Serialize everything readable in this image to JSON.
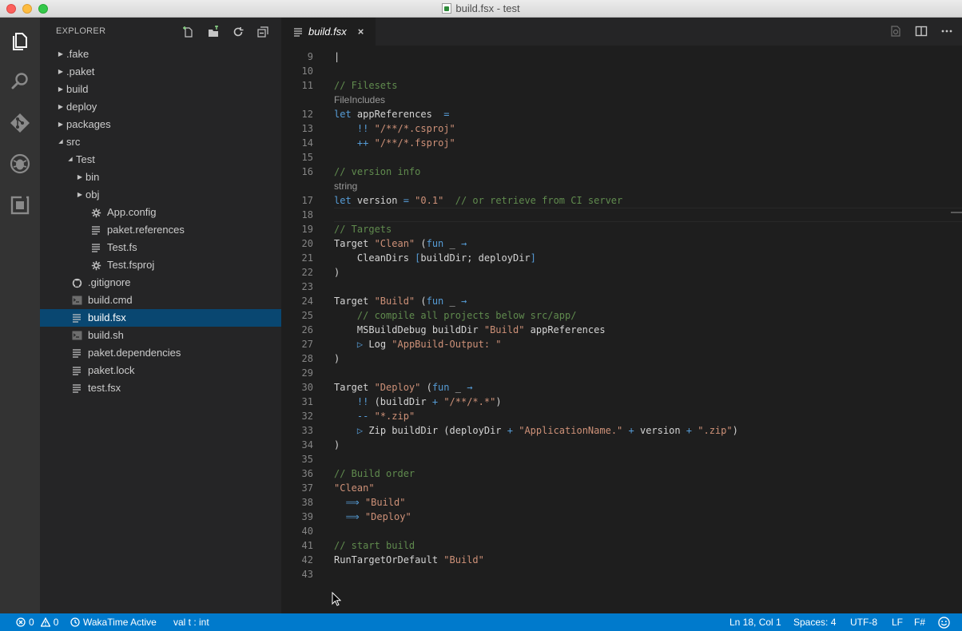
{
  "window": {
    "title": "build.fsx - test"
  },
  "sidebar": {
    "header": "EXPLORER",
    "tree": [
      {
        "label": ".fake",
        "depth": 0,
        "kind": "folder",
        "expanded": false
      },
      {
        "label": ".paket",
        "depth": 0,
        "kind": "folder",
        "expanded": false
      },
      {
        "label": "build",
        "depth": 0,
        "kind": "folder",
        "expanded": false
      },
      {
        "label": "deploy",
        "depth": 0,
        "kind": "folder",
        "expanded": false
      },
      {
        "label": "packages",
        "depth": 0,
        "kind": "folder",
        "expanded": false
      },
      {
        "label": "src",
        "depth": 0,
        "kind": "folder",
        "expanded": true
      },
      {
        "label": "Test",
        "depth": 1,
        "kind": "folder",
        "expanded": true
      },
      {
        "label": "bin",
        "depth": 2,
        "kind": "folder",
        "expanded": false
      },
      {
        "label": "obj",
        "depth": 2,
        "kind": "folder",
        "expanded": false
      },
      {
        "label": "App.config",
        "depth": 3,
        "kind": "gear"
      },
      {
        "label": "paket.references",
        "depth": 3,
        "kind": "lines"
      },
      {
        "label": "Test.fs",
        "depth": 3,
        "kind": "lines"
      },
      {
        "label": "Test.fsproj",
        "depth": 3,
        "kind": "gear"
      },
      {
        "label": ".gitignore",
        "depth": 1,
        "kind": "github"
      },
      {
        "label": "build.cmd",
        "depth": 1,
        "kind": "terminal"
      },
      {
        "label": "build.fsx",
        "depth": 1,
        "kind": "lines",
        "selected": true
      },
      {
        "label": "build.sh",
        "depth": 1,
        "kind": "terminal"
      },
      {
        "label": "paket.dependencies",
        "depth": 1,
        "kind": "lines"
      },
      {
        "label": "paket.lock",
        "depth": 1,
        "kind": "lines"
      },
      {
        "label": "test.fsx",
        "depth": 1,
        "kind": "lines"
      }
    ]
  },
  "editor": {
    "tab_label": "build.fsx",
    "tab_close": "×",
    "lines": [
      {
        "n": "9",
        "tokens": [
          [
            "|    ",
            "t-id"
          ]
        ]
      },
      {
        "n": "10",
        "tokens": []
      },
      {
        "n": "11",
        "tokens": [
          [
            "// Filesets",
            "t-c"
          ]
        ]
      },
      {
        "lens": "FileIncludes"
      },
      {
        "n": "12",
        "tokens": [
          [
            "let ",
            "t-k"
          ],
          [
            "appReferences",
            "t-id"
          ],
          [
            "  =",
            "t-o"
          ]
        ]
      },
      {
        "n": "13",
        "tokens": [
          [
            "    ",
            "t-id"
          ],
          [
            "!!",
            "t-o"
          ],
          [
            " ",
            "t-id"
          ],
          [
            "\"/**/*.csproj\"",
            "t-s"
          ]
        ]
      },
      {
        "n": "14",
        "tokens": [
          [
            "    ",
            "t-id"
          ],
          [
            "++",
            "t-o"
          ],
          [
            " ",
            "t-id"
          ],
          [
            "\"/**/*.fsproj\"",
            "t-s"
          ]
        ]
      },
      {
        "n": "15",
        "tokens": []
      },
      {
        "n": "16",
        "tokens": [
          [
            "// version info",
            "t-c"
          ]
        ]
      },
      {
        "lens": "string"
      },
      {
        "n": "17",
        "tokens": [
          [
            "let ",
            "t-k"
          ],
          [
            "version",
            "t-id"
          ],
          [
            " = ",
            "t-o"
          ],
          [
            "\"0.1\"",
            "t-s"
          ],
          [
            "  // or retrieve from CI server",
            "t-c"
          ]
        ]
      },
      {
        "n": "18",
        "tokens": [],
        "current": true
      },
      {
        "n": "19",
        "tokens": [
          [
            "// Targets",
            "t-c"
          ]
        ]
      },
      {
        "n": "20",
        "tokens": [
          [
            "Target ",
            "t-id"
          ],
          [
            "\"Clean\"",
            "t-s"
          ],
          [
            " (",
            "t-id"
          ],
          [
            "fun",
            "t-k"
          ],
          [
            " _ ",
            "t-id"
          ],
          [
            "→",
            "t-o"
          ]
        ]
      },
      {
        "n": "21",
        "tokens": [
          [
            "    CleanDirs ",
            "t-id"
          ],
          [
            "[",
            "t-k"
          ],
          [
            "buildDir; deployDir",
            "t-id"
          ],
          [
            "]",
            "t-k"
          ]
        ]
      },
      {
        "n": "22",
        "tokens": [
          [
            ")",
            "t-id"
          ]
        ]
      },
      {
        "n": "23",
        "tokens": []
      },
      {
        "n": "24",
        "tokens": [
          [
            "Target ",
            "t-id"
          ],
          [
            "\"Build\"",
            "t-s"
          ],
          [
            " (",
            "t-id"
          ],
          [
            "fun",
            "t-k"
          ],
          [
            " _ ",
            "t-id"
          ],
          [
            "→",
            "t-o"
          ]
        ]
      },
      {
        "n": "25",
        "tokens": [
          [
            "    // compile all projects below src/app/",
            "t-c"
          ]
        ]
      },
      {
        "n": "26",
        "tokens": [
          [
            "    MSBuildDebug buildDir ",
            "t-id"
          ],
          [
            "\"Build\"",
            "t-s"
          ],
          [
            " appReferences",
            "t-id"
          ]
        ]
      },
      {
        "n": "27",
        "tokens": [
          [
            "    ",
            "t-id"
          ],
          [
            "▷",
            "t-o"
          ],
          [
            " Log ",
            "t-id"
          ],
          [
            "\"AppBuild-Output: \"",
            "t-s"
          ]
        ]
      },
      {
        "n": "28",
        "tokens": [
          [
            ")",
            "t-id"
          ]
        ]
      },
      {
        "n": "29",
        "tokens": []
      },
      {
        "n": "30",
        "tokens": [
          [
            "Target ",
            "t-id"
          ],
          [
            "\"Deploy\"",
            "t-s"
          ],
          [
            " (",
            "t-id"
          ],
          [
            "fun",
            "t-k"
          ],
          [
            " _ ",
            "t-id"
          ],
          [
            "→",
            "t-o"
          ]
        ]
      },
      {
        "n": "31",
        "tokens": [
          [
            "    ",
            "t-id"
          ],
          [
            "!!",
            "t-o"
          ],
          [
            " (buildDir ",
            "t-id"
          ],
          [
            "+",
            "t-o"
          ],
          [
            " ",
            "t-id"
          ],
          [
            "\"/**/*.*\"",
            "t-s"
          ],
          [
            ")",
            "t-id"
          ]
        ]
      },
      {
        "n": "32",
        "tokens": [
          [
            "    ",
            "t-id"
          ],
          [
            "--",
            "t-o"
          ],
          [
            " ",
            "t-id"
          ],
          [
            "\"*.zip\"",
            "t-s"
          ]
        ]
      },
      {
        "n": "33",
        "tokens": [
          [
            "    ",
            "t-id"
          ],
          [
            "▷",
            "t-o"
          ],
          [
            " Zip buildDir (deployDir ",
            "t-id"
          ],
          [
            "+",
            "t-o"
          ],
          [
            " ",
            "t-id"
          ],
          [
            "\"ApplicationName.\"",
            "t-s"
          ],
          [
            " ",
            "t-id"
          ],
          [
            "+",
            "t-o"
          ],
          [
            " version ",
            "t-id"
          ],
          [
            "+",
            "t-o"
          ],
          [
            " ",
            "t-id"
          ],
          [
            "\".zip\"",
            "t-s"
          ],
          [
            ")",
            "t-id"
          ]
        ]
      },
      {
        "n": "34",
        "tokens": [
          [
            ")",
            "t-id"
          ]
        ]
      },
      {
        "n": "35",
        "tokens": []
      },
      {
        "n": "36",
        "tokens": [
          [
            "// Build order",
            "t-c"
          ]
        ]
      },
      {
        "n": "37",
        "tokens": [
          [
            "\"Clean\"",
            "t-s"
          ]
        ]
      },
      {
        "n": "38",
        "tokens": [
          [
            "  ",
            "t-id"
          ],
          [
            "⟹",
            "t-o"
          ],
          [
            " ",
            "t-id"
          ],
          [
            "\"Build\"",
            "t-s"
          ]
        ]
      },
      {
        "n": "39",
        "tokens": [
          [
            "  ",
            "t-id"
          ],
          [
            "⟹",
            "t-o"
          ],
          [
            " ",
            "t-id"
          ],
          [
            "\"Deploy\"",
            "t-s"
          ]
        ]
      },
      {
        "n": "40",
        "tokens": []
      },
      {
        "n": "41",
        "tokens": [
          [
            "// start build",
            "t-c"
          ]
        ]
      },
      {
        "n": "42",
        "tokens": [
          [
            "RunTargetOrDefault ",
            "t-id"
          ],
          [
            "\"Build\"",
            "t-s"
          ]
        ]
      },
      {
        "n": "43",
        "tokens": []
      }
    ]
  },
  "statusbar": {
    "errors": "0",
    "warnings": "0",
    "wakatime": "WakaTime Active",
    "type_info": "val t : int",
    "position": "Ln 18, Col 1",
    "spaces": "Spaces: 4",
    "encoding": "UTF-8",
    "eol": "LF",
    "language": "F#"
  },
  "colors": {
    "accent": "#007acc",
    "selection": "#094771",
    "comment": "#608b4e",
    "keyword": "#569cd6",
    "string": "#ce9178"
  }
}
